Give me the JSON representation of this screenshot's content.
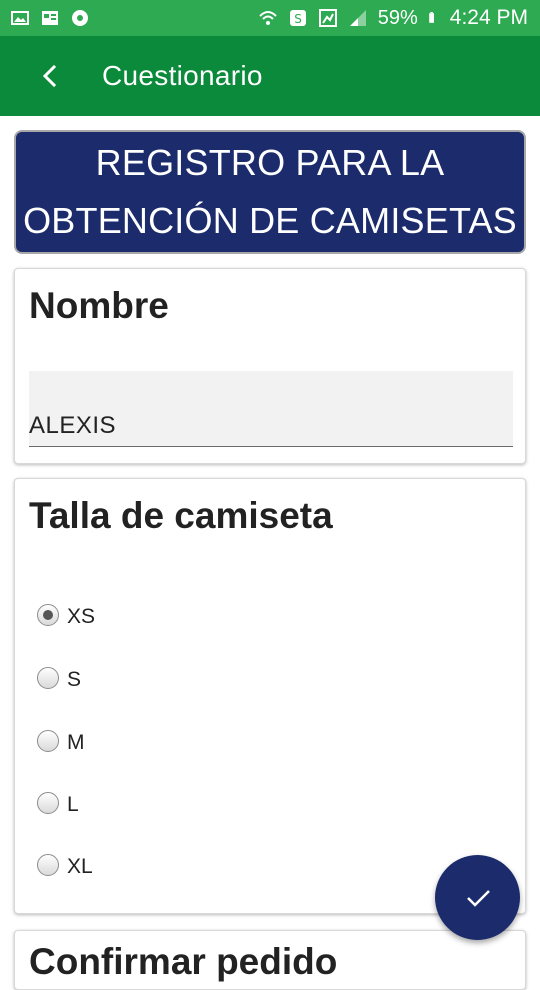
{
  "status_bar": {
    "battery": "59%",
    "time": "4:24 PM"
  },
  "app_bar": {
    "title": "Cuestionario"
  },
  "banner": {
    "line1": "REGISTRO PARA LA",
    "line2": "OBTENCIÓN DE CAMISETAS"
  },
  "name_card": {
    "title": "Nombre",
    "value": "ALEXIS"
  },
  "size_card": {
    "title": "Talla de camiseta",
    "options": [
      "XS",
      "S",
      "M",
      "L",
      "XL"
    ],
    "selected": "XS"
  },
  "confirm_card": {
    "title": "Confirmar pedido"
  },
  "colors": {
    "status_bar": "#2eaa52",
    "app_bar": "#0a8a3a",
    "banner": "#1b2b6b",
    "fab": "#1b2b6b"
  },
  "icons": {
    "back": "arrow-back-icon",
    "fab": "check-icon"
  }
}
